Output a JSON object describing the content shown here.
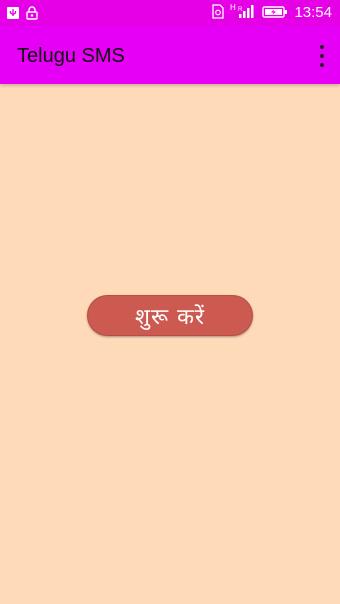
{
  "status_bar": {
    "time": "13:54",
    "network": "H",
    "icons": [
      "usb-icon",
      "lock-icon",
      "sim-icon",
      "signal-icon",
      "battery-charging-icon"
    ]
  },
  "app_bar": {
    "title": "Telugu SMS",
    "overflow_icon": "more-vertical-icon"
  },
  "main": {
    "start_button_label": "शुरू करें"
  },
  "colors": {
    "status_bar": "#E600E6",
    "app_bar": "#E600F5",
    "background": "#FFDAB9",
    "button": "#CC5A50"
  }
}
